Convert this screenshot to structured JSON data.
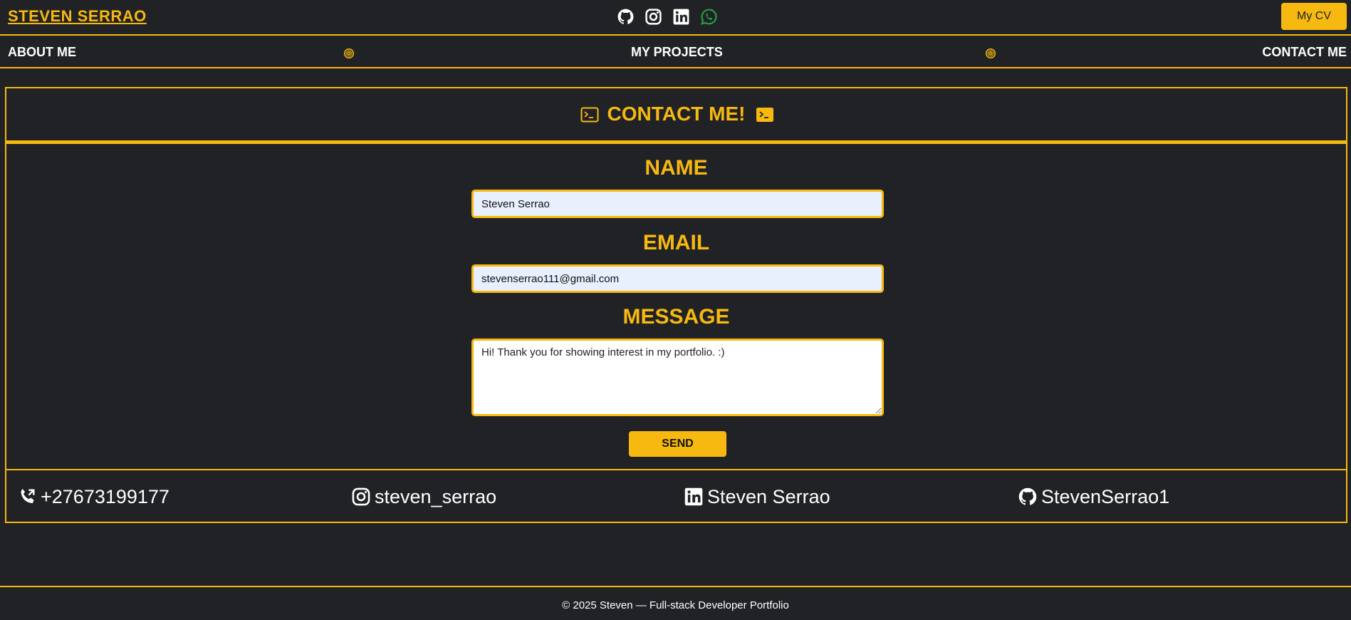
{
  "header": {
    "brand": "STEVEN SERRAO",
    "socials": [
      "github-icon",
      "instagram-icon",
      "linkedin-icon",
      "whatsapp-icon"
    ],
    "cv_button": "My CV"
  },
  "nav": {
    "items": [
      {
        "label": "ABOUT ME"
      },
      {
        "label": "MY PROJECTS"
      },
      {
        "label": "CONTACT ME"
      }
    ],
    "separator_icon": "target-icon"
  },
  "contact": {
    "title": "CONTACT ME!",
    "name": {
      "label": "NAME",
      "value": "Steven Serrao"
    },
    "email": {
      "label": "EMAIL",
      "value": "stevenserrao111@gmail.com"
    },
    "message": {
      "label": "MESSAGE",
      "value": "Hi! Thank you for showing interest in my portfolio. :)"
    },
    "send_label": "SEND"
  },
  "contact_links": [
    {
      "icon": "phone-icon",
      "text": "+27673199177"
    },
    {
      "icon": "instagram-icon",
      "text": "steven_serrao"
    },
    {
      "icon": "linkedin-icon",
      "text": "Steven Serrao"
    },
    {
      "icon": "github-icon",
      "text": "StevenSerrao1"
    }
  ],
  "footer": {
    "text": "© 2025 Steven — Full-stack Developer Portfolio"
  },
  "colors": {
    "accent": "#f7b90f",
    "background": "#212226",
    "whatsapp": "#25a244"
  }
}
